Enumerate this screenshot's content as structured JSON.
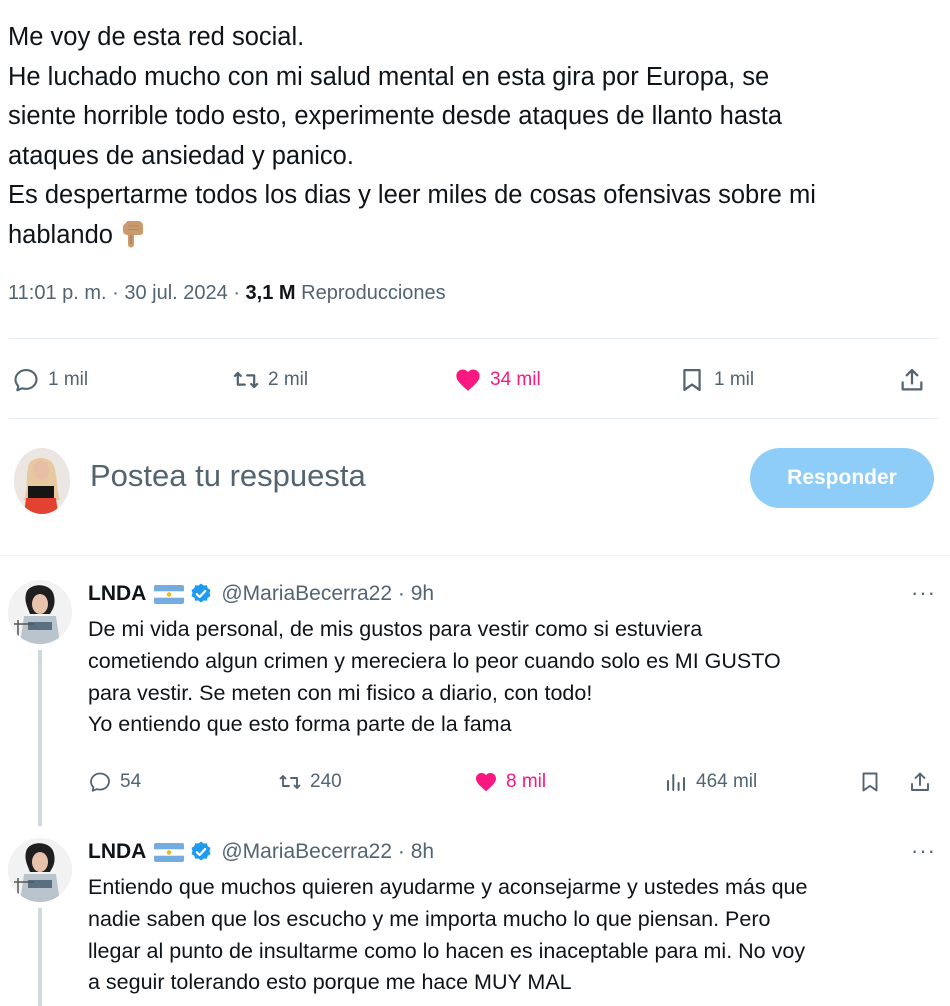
{
  "tweet": {
    "lines": [
      "Me voy de esta red social.",
      "He luchado mucho con mi salud mental en esta gira por Europa, se",
      "siente horrible todo esto, experimente desde ataques de llanto hasta",
      "ataques de ansiedad y panico.",
      "Es despertarme todos los dias y leer miles de cosas ofensivas sobre mi",
      "hablando"
    ],
    "emoji": "backhand-index-pointing-down",
    "time": "11:01 p. m. · 30 jul. 2024 · ",
    "views_count": "3,1 M",
    "views_label": " Reproducciones",
    "actions": {
      "replies": "1 mil",
      "reposts": "2 mil",
      "likes": "34 mil",
      "bookmarks": "1 mil"
    }
  },
  "composer": {
    "placeholder": "Postea tu respuesta",
    "button": "Responder"
  },
  "replies": [
    {
      "name": "LNDA",
      "handle": "@MariaBecerra22 · 9h",
      "more": "···",
      "lines": [
        "De mi vida personal, de mis gustos para vestir como si estuviera",
        "cometiendo algun crimen y mereciera lo peor cuando solo es MI GUSTO",
        "para vestir. Se meten con mi fisico a diario, con todo!",
        "Yo entiendo que esto forma parte de la fama"
      ],
      "actions": {
        "replies": "54",
        "reposts": "240",
        "likes": "8 mil",
        "views": "464 mil"
      }
    },
    {
      "name": "LNDA",
      "handle": "@MariaBecerra22 · 8h",
      "more": "···",
      "lines": [
        "Entiendo que muchos quieren ayudarme y aconsejarme y ustedes más que",
        "nadie saben que los escucho y me importa mucho lo que piensan. Pero",
        "llegar al punto de insultarme como lo hacen es inaceptable para mi. No voy",
        "a seguir tolerando esto porque me hace MUY MAL"
      ]
    }
  ],
  "colors": {
    "text": "#0f1419",
    "secondary": "#536471",
    "like": "#f91880",
    "accent": "#1d9bf0",
    "button_disabled": "#8ecdf8"
  }
}
